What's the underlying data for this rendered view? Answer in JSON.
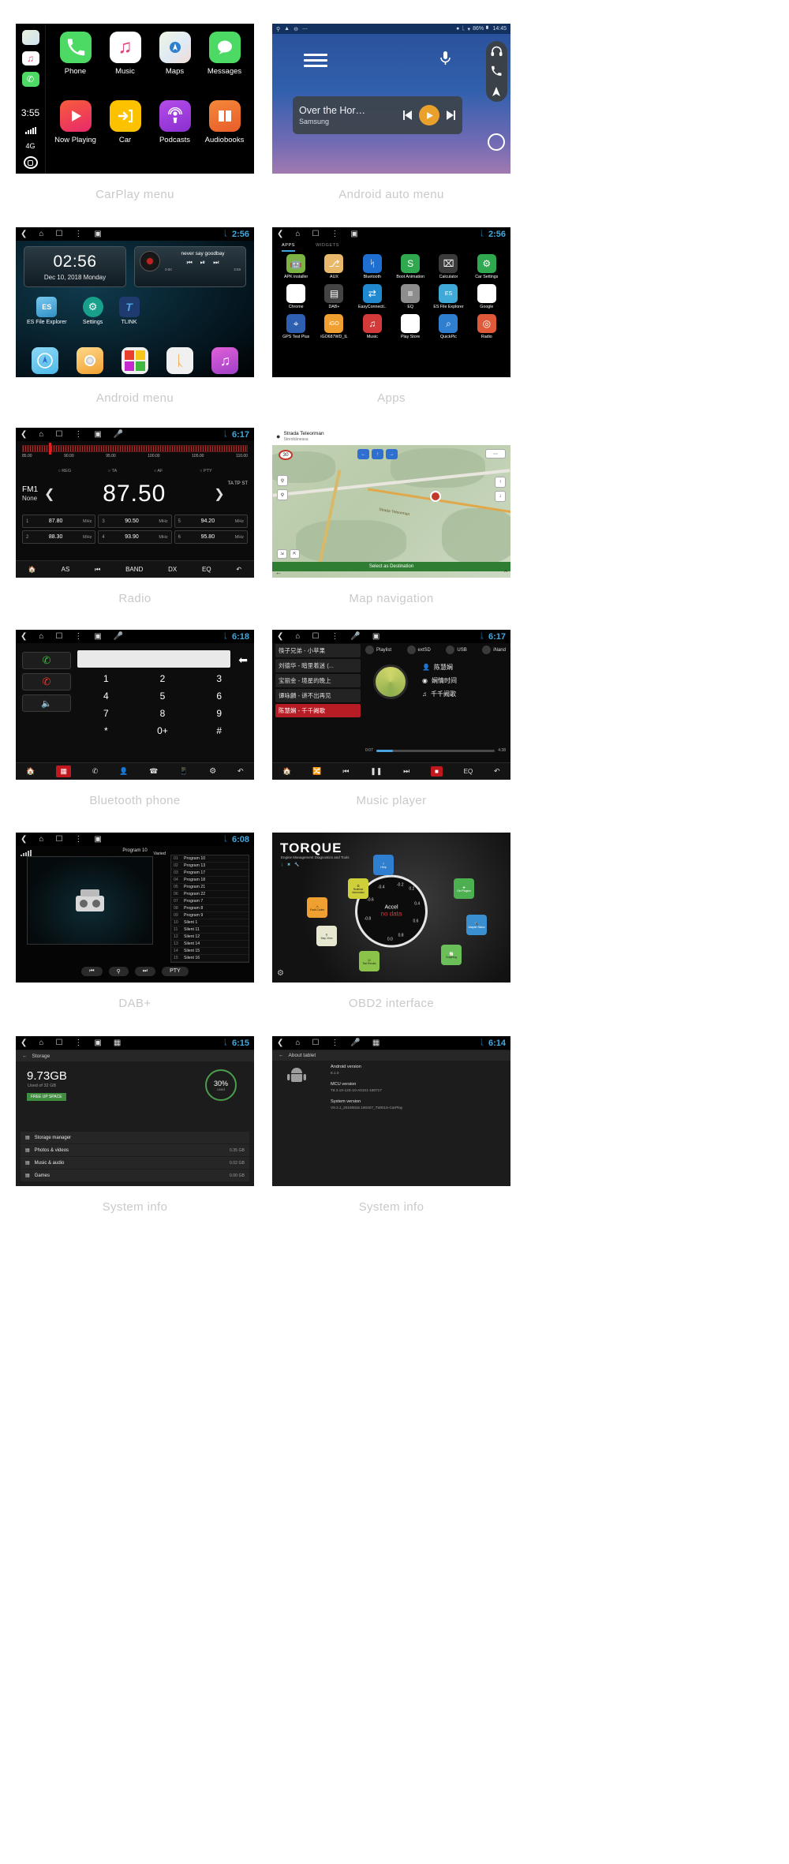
{
  "panels": [
    {
      "caption": "CarPlay menu",
      "type": "carplay",
      "status": {
        "time": "3:55",
        "network": "4G"
      },
      "rail_icons": [
        "maps-icon",
        "music-icon",
        "phone-icon"
      ],
      "apps": [
        {
          "label": "Phone",
          "icon": "phone-icon",
          "color": "#4cd964"
        },
        {
          "label": "Music",
          "icon": "music-icon",
          "color": "#ffffff"
        },
        {
          "label": "Maps",
          "icon": "maps-icon",
          "color": "#ffffff"
        },
        {
          "label": "Messages",
          "icon": "messages-icon",
          "color": "#4cd964"
        },
        {
          "label": "Now Playing",
          "icon": "play-icon",
          "color": "#f0473f"
        },
        {
          "label": "Car",
          "icon": "car-exit-icon",
          "color": "#fcc200"
        },
        {
          "label": "Podcasts",
          "icon": "podcasts-icon",
          "color": "#a64de0"
        },
        {
          "label": "Audiobooks",
          "icon": "book-icon",
          "color": "#f2722b"
        }
      ]
    },
    {
      "caption": "Android auto menu",
      "type": "androidauto",
      "status": {
        "time": "14:45",
        "battery": "86%",
        "icons": [
          "location-icon",
          "bluetooth-icon",
          "wifi-icon",
          "signal-icon"
        ]
      },
      "statusbar_left_icons": [
        "search-icon",
        "navigation-icon",
        "minus-circle-icon",
        "overflow-icon"
      ],
      "media": {
        "title": "Over the Hor…",
        "artist": "Samsung"
      },
      "rail": [
        "headphones-icon",
        "phone-icon",
        "navigation-icon",
        "home-circle-icon"
      ],
      "mic": "mic-icon",
      "menu": "hamburger-icon"
    },
    {
      "caption": "Android menu",
      "type": "androidhome",
      "status": {
        "time": "2:56",
        "bluetooth": "bluetooth-icon"
      },
      "nav": [
        "back-icon",
        "home-icon",
        "recents-icon",
        "overflow-icon",
        "screenshot-icon"
      ],
      "clock": {
        "time": "02:56",
        "date": "Dec 10, 2018  Monday"
      },
      "player": {
        "title": "never say goodbay",
        "elapsed": "0:00",
        "duration": "3:59"
      },
      "shortcuts": [
        {
          "label": "ES File Explorer",
          "icon": "es-file-explorer-icon",
          "color": "#3fa9d8"
        },
        {
          "label": "Settings",
          "icon": "gear-icon",
          "color": "#18a08a"
        },
        {
          "label": "TLINK",
          "icon": "tlink-icon",
          "color": "#1e3a6e"
        }
      ],
      "dock": [
        "navigation-icon",
        "radio-icon",
        "apps-grid-icon",
        "bluetooth-icon",
        "music-icon"
      ]
    },
    {
      "caption": "Apps",
      "type": "appsdrawer",
      "status": {
        "time": "2:56",
        "bluetooth": "bluetooth-icon"
      },
      "nav": [
        "back-icon",
        "home-icon",
        "recents-icon",
        "overflow-icon",
        "screenshot-icon"
      ],
      "tabs": [
        "APPS",
        "WIDGETS"
      ],
      "active_tab": "APPS",
      "apps": [
        {
          "label": "APK installer",
          "icon": "android-icon",
          "color": "#7cb342"
        },
        {
          "label": "AUX",
          "icon": "aux-icon",
          "color": "#e8b96a"
        },
        {
          "label": "Bluetooth",
          "icon": "bluetooth-icon",
          "color": "#1f6fd0"
        },
        {
          "label": "Boot Animation",
          "icon": "boot-animation-icon",
          "color": "#2fa84f"
        },
        {
          "label": "Calculator",
          "icon": "calculator-icon",
          "color": "#3b3b3b"
        },
        {
          "label": "Car Settings",
          "icon": "car-settings-icon",
          "color": "#2fa84f"
        },
        {
          "label": "Chrome",
          "icon": "chrome-icon",
          "color": "#ffffff"
        },
        {
          "label": "DAB+",
          "icon": "dab-icon",
          "color": "#444444"
        },
        {
          "label": "EasyConnecti..",
          "icon": "easyconnect-icon",
          "color": "#1f8ad0"
        },
        {
          "label": "EQ",
          "icon": "eq-icon",
          "color": "#8d8d8d"
        },
        {
          "label": "ES File Explorer",
          "icon": "es-file-explorer-icon",
          "color": "#3fa9d8"
        },
        {
          "label": "Google",
          "icon": "google-icon",
          "color": "#ffffff"
        },
        {
          "label": "GPS Test Plus",
          "icon": "gps-test-icon",
          "color": "#2f5fb0"
        },
        {
          "label": "iGO687WD_IL",
          "icon": "igo-icon",
          "color": "#f0a030"
        },
        {
          "label": "Music",
          "icon": "music-icon",
          "color": "#d33a3a"
        },
        {
          "label": "Play Store",
          "icon": "play-store-icon",
          "color": "#ffffff"
        },
        {
          "label": "QuickPic",
          "icon": "quickpic-icon",
          "color": "#2f7fd0"
        },
        {
          "label": "Radio",
          "icon": "radio-icon",
          "color": "#e05a3a"
        }
      ]
    },
    {
      "caption": "Radio",
      "type": "radio",
      "status": {
        "time": "6:17",
        "bluetooth": "bluetooth-icon"
      },
      "nav": [
        "back-icon",
        "home-icon",
        "recents-icon",
        "overflow-icon",
        "apps-icon",
        "mic-icon"
      ],
      "scale_ticks": [
        "85.00",
        "90.00",
        "95.00",
        "100.00",
        "105.00",
        "110.00"
      ],
      "options": [
        "REG",
        "TA",
        "AF",
        "PTY"
      ],
      "band": "FM1",
      "pty": "None",
      "frequency": "87.50",
      "indicators": "TA TP ST",
      "presets": [
        {
          "n": "1",
          "v": "87.80",
          "u": "MHz"
        },
        {
          "n": "3",
          "v": "90.50",
          "u": "MHz"
        },
        {
          "n": "5",
          "v": "94.20",
          "u": "MHz"
        },
        {
          "n": "2",
          "v": "88.30",
          "u": "MHz"
        },
        {
          "n": "4",
          "v": "93.90",
          "u": "MHz"
        },
        {
          "n": "6",
          "v": "95.80",
          "u": "MHz"
        }
      ],
      "bottom": [
        "home-icon",
        "AS",
        "prev-icon",
        "BAND",
        "DX",
        "EQ",
        "back-arrow-icon"
      ]
    },
    {
      "caption": "Map navigation",
      "type": "map",
      "title": "Strada Teleorman",
      "subtitle": "Storobăneasa",
      "speed_limit": "30",
      "zoom_in": "zoom-in-icon",
      "zoom_out": "zoom-out-icon",
      "road_label": "Strada Teleorman",
      "action": "Select as Destination",
      "controls": [
        "left-arrow-icon",
        "up-arrow-icon",
        "right-arrow-icon",
        "menu-icon",
        "target-icon",
        "expand-icon",
        "collapse-icon"
      ]
    },
    {
      "caption": "Bluetooth phone",
      "type": "btphone",
      "status": {
        "time": "6:18",
        "bluetooth": "bluetooth-icon"
      },
      "nav": [
        "back-icon",
        "home-icon",
        "recents-icon",
        "overflow-icon",
        "apps-icon",
        "mic-icon"
      ],
      "number": "",
      "keys": [
        "1",
        "2",
        "3",
        "4",
        "5",
        "6",
        "7",
        "8",
        "9",
        "*",
        "0+",
        "#"
      ],
      "actions": [
        "call-icon",
        "hangup-icon",
        "mute-icon"
      ],
      "bottom": [
        "home-icon",
        "keypad-icon",
        "recents-call-icon",
        "contacts-icon",
        "dial-icon",
        "device-icon",
        "gear-icon",
        "back-arrow-icon"
      ]
    },
    {
      "caption": "Music player",
      "type": "music",
      "status": {
        "time": "6:17",
        "bluetooth": "bluetooth-icon"
      },
      "nav": [
        "back-icon",
        "home-icon",
        "recents-icon",
        "overflow-icon",
        "mic-icon",
        "apps-icon"
      ],
      "sources": [
        "Playlist",
        "extSD",
        "USB",
        "iNand"
      ],
      "playlist": [
        "筷子兄弟 - 小苹果",
        "刘德华 - 暗里着迷 (...",
        "宝丽金 - 境星的晚上",
        "谭咏麟 - 讲不出再见",
        "陈慧娴 - 千千阙歌"
      ],
      "active_index": 4,
      "now": {
        "artist": "陈慧娴",
        "album": "娴情时间",
        "track": "千千阙歌"
      },
      "elapsed": "0:07",
      "duration": "4:38",
      "bottom": [
        "home-icon",
        "shuffle-icon",
        "prev-icon",
        "pause-icon",
        "next-icon",
        "stop-icon",
        "EQ",
        "back-arrow-icon"
      ]
    },
    {
      "caption": "DAB+",
      "type": "dab",
      "status": {
        "time": "6:08",
        "bluetooth": "bluetooth-icon"
      },
      "nav": [
        "back-icon",
        "home-icon",
        "recents-icon",
        "overflow-icon",
        "apps-icon"
      ],
      "title": "Program 10",
      "variant": "Varied",
      "stations": [
        {
          "i": "01",
          "n": "Program 10"
        },
        {
          "i": "02",
          "n": "Program 13"
        },
        {
          "i": "03",
          "n": "Program 17"
        },
        {
          "i": "04",
          "n": "Program 18"
        },
        {
          "i": "05",
          "n": "Program 21"
        },
        {
          "i": "06",
          "n": "Program 22"
        },
        {
          "i": "07",
          "n": "Program 7"
        },
        {
          "i": "08",
          "n": "Program 8"
        },
        {
          "i": "09",
          "n": "Program 9"
        },
        {
          "i": "10",
          "n": "Silent 1"
        },
        {
          "i": "11",
          "n": "Silent 11"
        },
        {
          "i": "12",
          "n": "Silent 12"
        },
        {
          "i": "13",
          "n": "Silent 14"
        },
        {
          "i": "14",
          "n": "Silent 15"
        },
        {
          "i": "15",
          "n": "Silent 16"
        }
      ],
      "buttons": [
        "prev-icon",
        "search-icon",
        "next-icon",
        "PTY"
      ]
    },
    {
      "caption": "OBD2 interface",
      "type": "obd",
      "brand": "TORQUE",
      "tagline": "Engine Management Diagnostics and Tools",
      "gauge_label": "Accel",
      "gauge_value": "no data",
      "gauge_ticks": [
        "-0.8",
        "-0.6",
        "-0.4",
        "-0.2",
        "0.2",
        "0.4",
        "0.6",
        "0.8",
        "0.0"
      ],
      "widgets": [
        {
          "label": "Help",
          "icon": "help-icon",
          "color": "#2f7fd0"
        },
        {
          "label": "Realtime Information",
          "icon": "realtime-icon",
          "color": "#cfcf3a"
        },
        {
          "label": "Get Plugins",
          "icon": "plugins-icon",
          "color": "#4caf50"
        },
        {
          "label": "Fault Codes",
          "icon": "fault-icon",
          "color": "#f0a030"
        },
        {
          "label": "Map View",
          "icon": "map-icon",
          "color": "#e8e8d0"
        },
        {
          "label": "Adapter Status",
          "icon": "adapter-icon",
          "color": "#3a8fd0"
        },
        {
          "label": "Test Results",
          "icon": "results-icon",
          "color": "#8bc34a"
        },
        {
          "label": "Graphing",
          "icon": "graph-icon",
          "color": "#6bbf59"
        }
      ],
      "settings_icon": "gear-icon"
    },
    {
      "caption": "System info",
      "type": "storage",
      "status": {
        "time": "6:15",
        "bluetooth": "bluetooth-icon"
      },
      "nav": [
        "back-icon",
        "home-icon",
        "recents-icon",
        "overflow-icon",
        "apps-icon",
        "grid-icon"
      ],
      "header": "Storage",
      "used_value": "9.73GB",
      "used_caption": "Used of 32 GB",
      "free_button": "FREE UP SPACE",
      "ring_percent": "30%",
      "ring_caption": "used",
      "rows": [
        {
          "label": "Storage manager",
          "size": "",
          "icon": "storage-icon"
        },
        {
          "label": "Photos & videos",
          "size": "0.35 GB",
          "icon": "photos-icon"
        },
        {
          "label": "Music & audio",
          "size": "0.02 GB",
          "icon": "music-icon"
        },
        {
          "label": "Games",
          "size": "0.00 GB",
          "icon": "games-icon"
        }
      ]
    },
    {
      "caption": "System info",
      "type": "about",
      "status": {
        "time": "6:14",
        "bluetooth": "bluetooth-icon"
      },
      "nav": [
        "back-icon",
        "home-icon",
        "recents-icon",
        "overflow-icon",
        "mic-icon",
        "grid-icon"
      ],
      "header": "About tablet",
      "items": [
        {
          "key": "Android version",
          "value": "8.1.0"
        },
        {
          "key": "MCU version",
          "value": "T8.3.19-12S-10-A0101-180717"
        },
        {
          "key": "System version",
          "value": "V9.3.1_20180816.190407_TWD1S-CarPlay"
        }
      ]
    }
  ]
}
